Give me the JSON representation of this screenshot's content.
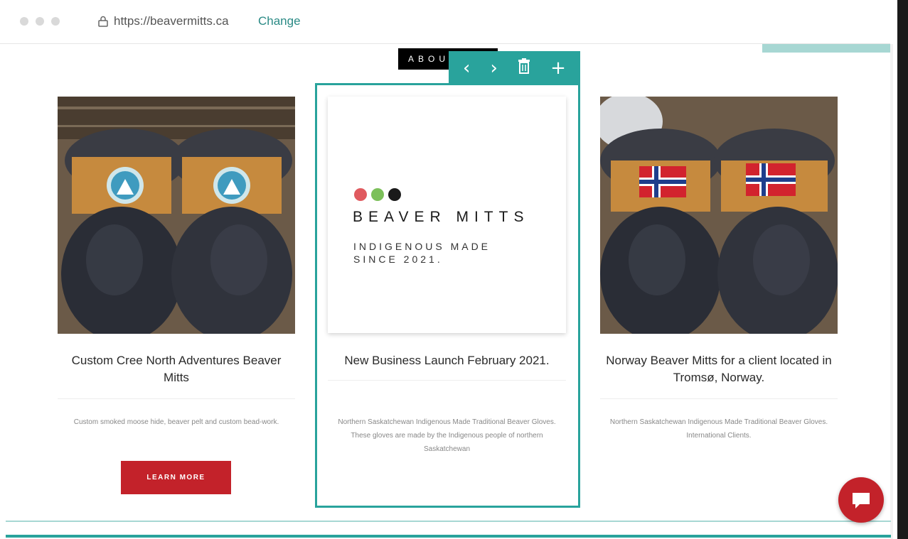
{
  "browser": {
    "url": "https://beavermitts.ca",
    "change_link": "Change"
  },
  "section": {
    "label": "ABOUT"
  },
  "editor_toolbar": {
    "prev": "‹",
    "next": "›",
    "add": "+"
  },
  "cards": [
    {
      "title": "Custom Cree North Adventures Beaver Mitts",
      "description": "Custom smoked moose hide, beaver pelt and custom bead-work.",
      "button": "LEARN MORE"
    },
    {
      "title": "New Business Launch February 2021.",
      "description": "Northern Saskatchewan Indigenous Made Traditional Beaver Gloves. These gloves are made by the Indigenous people of northern Saskatchewan",
      "logo": {
        "brand": "BEAVER MITTS",
        "tagline_line1": "INDIGENOUS MADE",
        "tagline_line2": "SINCE 2021.",
        "dot_colors": [
          "#e05a5f",
          "#7cc05a",
          "#1a1a1a"
        ]
      }
    },
    {
      "title": "Norway Beaver Mitts for a client located in Tromsø, Norway.",
      "description": "Northern Saskatchewan Indigenous Made Traditional Beaver Gloves. International Clients."
    }
  ],
  "colors": {
    "accent": "#29a39c",
    "button": "#c3222a"
  }
}
